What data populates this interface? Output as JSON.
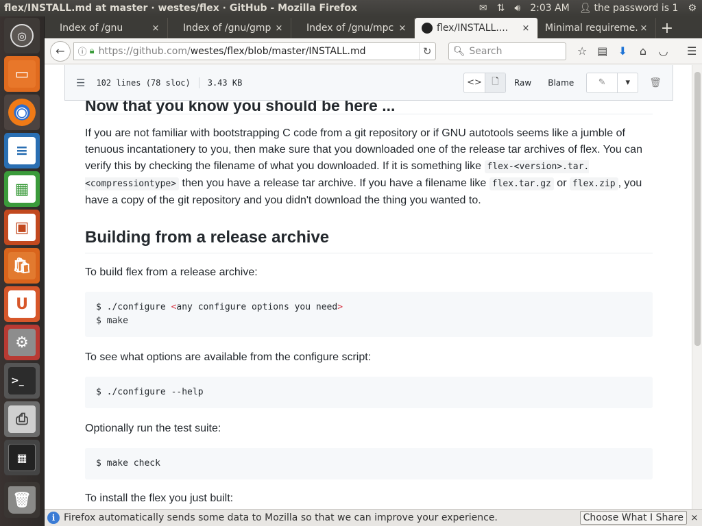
{
  "window": {
    "title": "flex/INSTALL.md at master · westes/flex · GitHub - Mozilla Firefox"
  },
  "tray": {
    "time": "2:03 AM",
    "user": "the password is 1"
  },
  "launcher": {
    "items": [
      "ubuntu-home-icon",
      "files-icon",
      "firefox-icon",
      "writer-icon",
      "calc-icon",
      "impress-icon",
      "software-center-icon",
      "ubuntu-one-icon",
      "system-settings-icon",
      "terminal-icon",
      "printer-icon",
      "workspace-switcher-icon",
      "trash-icon"
    ]
  },
  "tabs": [
    {
      "label": "Index of /gnu",
      "close": "×"
    },
    {
      "label": "Index of /gnu/gmp",
      "close": "×"
    },
    {
      "label": "Index of /gnu/mpc",
      "close": "×"
    },
    {
      "label": "flex/INSTALL....",
      "close": "×",
      "active": true
    },
    {
      "label": "Minimal requireme...",
      "close": "×"
    }
  ],
  "newtab": "+",
  "nav": {
    "url_light": "https://github.com/",
    "url_dark": "westes/flex/blob/master/INSTALL.md",
    "search_placeholder": "Search"
  },
  "file_header": {
    "lines": "102 lines (78 sloc)",
    "size": "3.43 KB",
    "raw": "Raw",
    "blame": "Blame"
  },
  "content": {
    "heading_cut": "Now that you know you should be here ...",
    "p1_a": "If you are not familiar with bootstrapping C code from a git repository or if GNU autotools seems like a jumble of tenuous incantationery to you, then make sure that you downloaded one of the release tar archives of flex. You can verify this by checking the filename of what you downloaded. If it is something like ",
    "p1_code1": "flex-<version>.tar.<compressiontype>",
    "p1_b": " then you have a release tar archive. If you have a filename like ",
    "p1_code2": "flex.tar.gz",
    "p1_c": " or ",
    "p1_code3": "flex.zip",
    "p1_d": ", you have a copy of the git repository and you didn't download the thing you wanted to.",
    "h_build": "Building from a release archive",
    "p_build": "To build flex from a release archive:",
    "code1_line1_a": "$ ./configure ",
    "code1_line1_lt": "<",
    "code1_line1_b": "any configure options you need",
    "code1_line1_gt": ">",
    "code1_line2": "$ make",
    "p_options": "To see what options are available from the configure script:",
    "code2": "$ ./configure --help",
    "p_test": "Optionally run the test suite:",
    "code3": "$ make check",
    "p_install_cut": "To install the flex you just built:"
  },
  "notification": {
    "text": "Firefox automatically sends some data to Mozilla so that we can improve your experience.",
    "button": "Choose What I Share",
    "close": "×"
  }
}
